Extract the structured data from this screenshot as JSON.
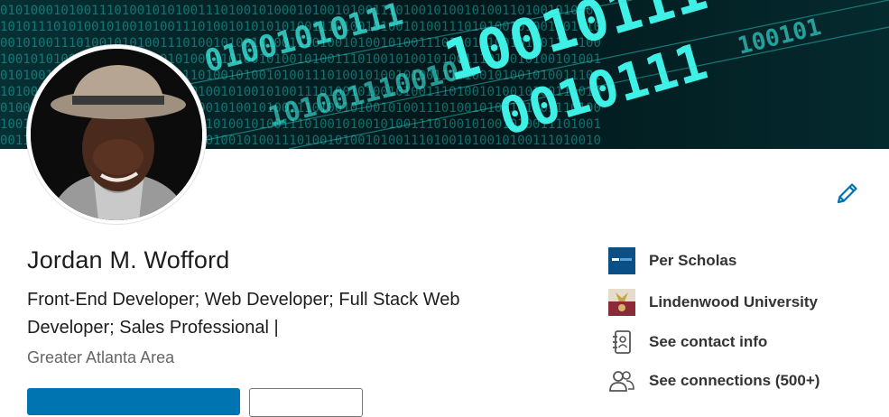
{
  "profile": {
    "name": "Jordan M. Wofford",
    "headline": "Front-End Developer; Web Developer; Full Stack Web Developer; Sales Professional |",
    "location": "Greater Atlanta Area"
  },
  "sidebar": {
    "items": [
      {
        "label": "Per Scholas",
        "icon": "per-scholas-logo"
      },
      {
        "label": "Lindenwood University",
        "icon": "lindenwood-logo"
      },
      {
        "label": "See contact info",
        "icon": "contact-book-icon"
      },
      {
        "label": "See connections (500+)",
        "icon": "people-icon"
      }
    ]
  },
  "colors": {
    "banner_background": "#021417",
    "binary_glow": "#2de0d8",
    "accent": "#0073b1",
    "text_primary": "#1d1d1d",
    "text_secondary": "#666666"
  }
}
